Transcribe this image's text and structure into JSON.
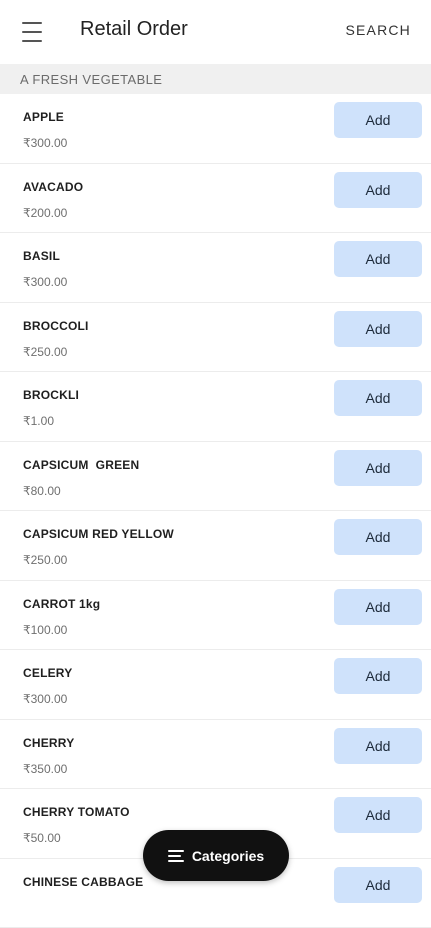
{
  "appbar": {
    "title": "Retail Order",
    "search_label": "SEARCH"
  },
  "section": {
    "title": "A FRESH VEGETABLE"
  },
  "add_label": "Add",
  "items": [
    {
      "name": "APPLE",
      "price": "₹300.00"
    },
    {
      "name": "AVACADO",
      "price": "₹200.00"
    },
    {
      "name": "BASIL",
      "price": "₹300.00"
    },
    {
      "name": "BROCCOLI",
      "price": "₹250.00"
    },
    {
      "name": "BROCKLI",
      "price": "₹1.00"
    },
    {
      "name": "CAPSICUM  GREEN",
      "price": "₹80.00"
    },
    {
      "name": "CAPSICUM RED YELLOW",
      "price": "₹250.00"
    },
    {
      "name": "CARROT 1kg",
      "price": "₹100.00"
    },
    {
      "name": "CELERY",
      "price": "₹300.00"
    },
    {
      "name": "CHERRY",
      "price": "₹350.00"
    },
    {
      "name": "CHERRY TOMATO",
      "price": "₹50.00"
    },
    {
      "name": "CHINESE CABBAGE",
      "price": ""
    }
  ],
  "fab": {
    "label": "Categories",
    "icon": "categories-list-icon"
  },
  "colors": {
    "add_button_bg": "#cfe2fb",
    "section_bg": "#f0f0f0",
    "fab_bg": "#111111"
  }
}
